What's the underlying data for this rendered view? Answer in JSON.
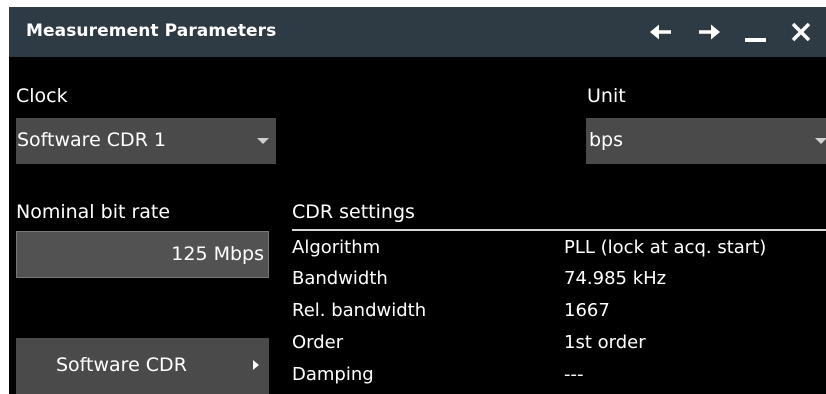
{
  "window": {
    "title": "Measurement Parameters"
  },
  "titlebar": {
    "icons": [
      "arrow-left-icon",
      "arrow-right-icon",
      "minimize-icon",
      "close-icon"
    ]
  },
  "clock": {
    "label": "Clock",
    "value": "Software CDR 1"
  },
  "unit": {
    "label": "Unit",
    "value": "bps"
  },
  "nominal_bit_rate": {
    "label": "Nominal bit rate",
    "value": "125 Mbps"
  },
  "software_cdr_button": {
    "label": "Software CDR"
  },
  "cdr_settings": {
    "heading": "CDR settings",
    "rows": [
      {
        "label": "Algorithm",
        "value": "PLL (lock at acq. start)"
      },
      {
        "label": "Bandwidth",
        "value": "74.985 kHz"
      },
      {
        "label": "Rel. bandwidth",
        "value": "1667"
      },
      {
        "label": "Order",
        "value": "1st order"
      },
      {
        "label": "Damping",
        "value": "---"
      }
    ]
  },
  "colors": {
    "titlebar": "#2e3b45",
    "background": "#000000",
    "control": "#4a4a4a",
    "text": "#ffffff"
  }
}
